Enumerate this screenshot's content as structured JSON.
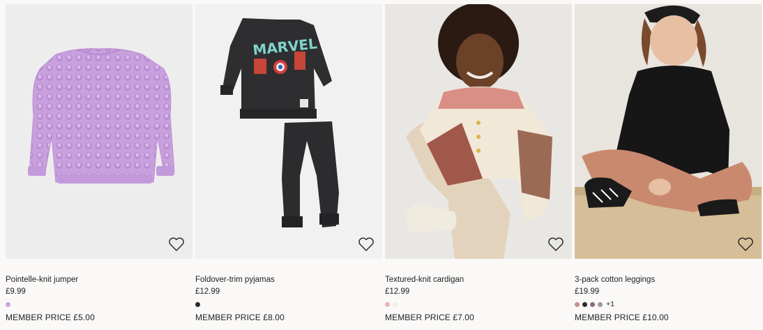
{
  "colors": {
    "background": "#faf9f8",
    "text": "#222222"
  },
  "products": [
    {
      "title": "Pointelle-knit jumper",
      "price": "£9.99",
      "member_price": "MEMBER PRICE £5.00",
      "swatches": [
        "#c9a6e0"
      ],
      "more": ""
    },
    {
      "title": "Foldover-trim pyjamas",
      "price": "£12.99",
      "member_price": "MEMBER PRICE £8.00",
      "swatches": [
        "#2b2b2b"
      ],
      "more": ""
    },
    {
      "title": "Textured-knit cardigan",
      "price": "£12.99",
      "member_price": "MEMBER PRICE £7.00",
      "swatches": [
        "#e8b6b6",
        "#efede8"
      ],
      "more": ""
    },
    {
      "title": "3-pack cotton leggings",
      "price": "£19.99",
      "member_price": "MEMBER PRICE £10.00",
      "swatches": [
        "#c78f8f",
        "#2b2b2b",
        "#8a6b78",
        "#9a9a9a"
      ],
      "more": "+1"
    }
  ],
  "icons": {
    "favourite": "heart-outline-icon"
  }
}
